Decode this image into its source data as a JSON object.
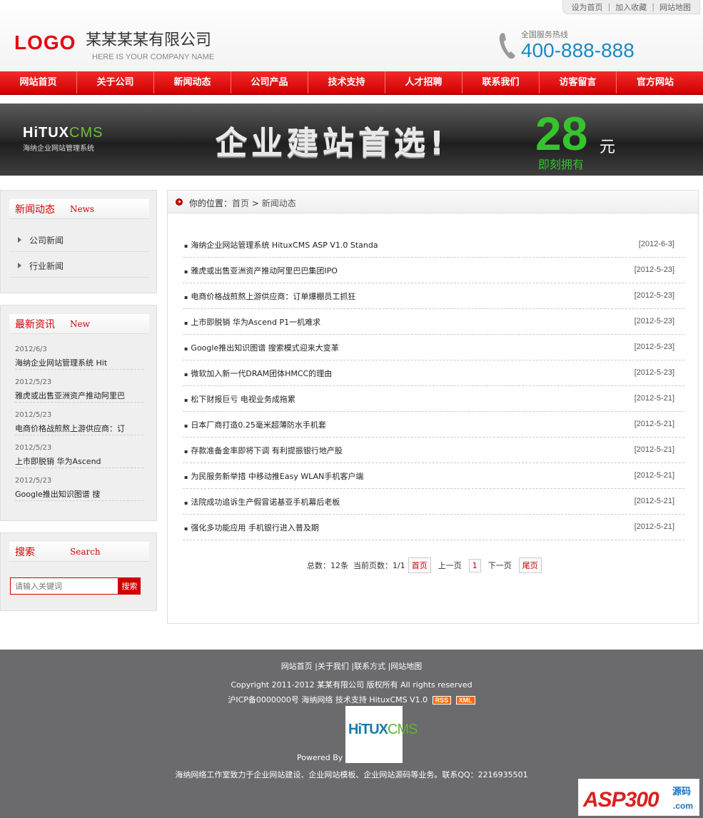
{
  "toplinks": [
    "设为首页",
    "加入收藏",
    "网站地图"
  ],
  "logo": "LOGO",
  "company": {
    "name": "某某某某有限公司",
    "en": "HERE IS YOUR COMPANY NAME"
  },
  "hotline": {
    "label": "全国服务热线",
    "number": "400-888-888"
  },
  "nav": [
    "网站首页",
    "关于公司",
    "新闻动态",
    "公司产品",
    "技术支持",
    "人才招聘",
    "联系我们",
    "访客留言",
    "官方网站"
  ],
  "banner": {
    "brand": "HiTUX",
    "brand_accent": "CMS",
    "brand_sub": "海纳企业网站管理系统",
    "slogan": "企业建站首选!",
    "price": "28",
    "unit": "元",
    "now": "即刻拥有"
  },
  "sidebar": {
    "news": {
      "title_cn": "新闻动态",
      "title_en": "News",
      "items": [
        "公司新闻",
        "行业新闻"
      ]
    },
    "latest": {
      "title_cn": "最新资讯",
      "title_en": "New",
      "items": [
        {
          "date": "2012/6/3",
          "title": "海纳企业网站管理系统 Hit"
        },
        {
          "date": "2012/5/23",
          "title": "雅虎或出售亚洲资产推动阿里巴"
        },
        {
          "date": "2012/5/23",
          "title": "电商价格战煎熬上游供应商：订"
        },
        {
          "date": "2012/5/23",
          "title": "上市即脱销 华为Ascend"
        },
        {
          "date": "2012/5/23",
          "title": "Google推出知识图谱 搜"
        }
      ]
    },
    "search": {
      "title_cn": "搜索",
      "title_en": "Search",
      "placeholder": "请输入关键词",
      "button": "搜索"
    }
  },
  "crumb": {
    "label": "你的位置：",
    "home": "首页",
    "sep": ">",
    "current": "新闻动态"
  },
  "news": [
    {
      "title": "海纳企业网站管理系统 HituxCMS ASP V1.0 Standa",
      "date": "[2012-6-3]"
    },
    {
      "title": "雅虎或出售亚洲资产推动阿里巴巴集团IPO",
      "date": "[2012-5-23]"
    },
    {
      "title": "电商价格战煎熬上游供应商：订单爆棚员工抓狂",
      "date": "[2012-5-23]"
    },
    {
      "title": "上市即脱销 华为Ascend P1一机难求",
      "date": "[2012-5-23]"
    },
    {
      "title": "Google推出知识图谱 搜索模式迎来大变革",
      "date": "[2012-5-23]"
    },
    {
      "title": "微软加入新一代DRAM团体HMCC的理由",
      "date": "[2012-5-23]"
    },
    {
      "title": "松下财报巨亏 电视业务成拖累",
      "date": "[2012-5-21]"
    },
    {
      "title": "日本厂商打造0.25毫米超薄防水手机套",
      "date": "[2012-5-21]"
    },
    {
      "title": "存款准备金率即将下调 有利提振银行地产股",
      "date": "[2012-5-21]"
    },
    {
      "title": "为民服务新举措 中移动推Easy WLAN手机客户端",
      "date": "[2012-5-21]"
    },
    {
      "title": "法院成功追诉生产假冒诺基亚手机幕后老板",
      "date": "[2012-5-21]"
    },
    {
      "title": "强化多功能应用 手机银行进入普及期",
      "date": "[2012-5-21]"
    }
  ],
  "pager": {
    "total": "总数：12条",
    "current": "当前页数：1/1",
    "first": "首页",
    "prev": "上一页",
    "page": "1",
    "next": "下一页",
    "last": "尾页"
  },
  "footer": {
    "links": "网站首页 |关于我们 |联系方式 |网站地图",
    "copyright": "Copyright 2011-2012 某某有限公司 版权所有  All rights reserved",
    "icp": "沪ICP备0000000号  海纳网络 技术支持  HituxCMS V1.0",
    "rss": "RSS",
    "xml": "XML",
    "logo_a": "HiTUX",
    "logo_b": "CMS",
    "powered": "Powered By",
    "desc": "海纳网络工作室致力于企业网站建设、企业网站模板、企业网站源码等业务。联系QQ：2216935501"
  },
  "watermark": {
    "brand": "ASP300",
    "cn": "源码",
    "domain": ".com"
  },
  "colors": {
    "accent": "#d00000",
    "nav": "#e60012",
    "hotline": "#1a88c6",
    "footer": "#6b6a6c",
    "banner_green": "#35c42d"
  }
}
